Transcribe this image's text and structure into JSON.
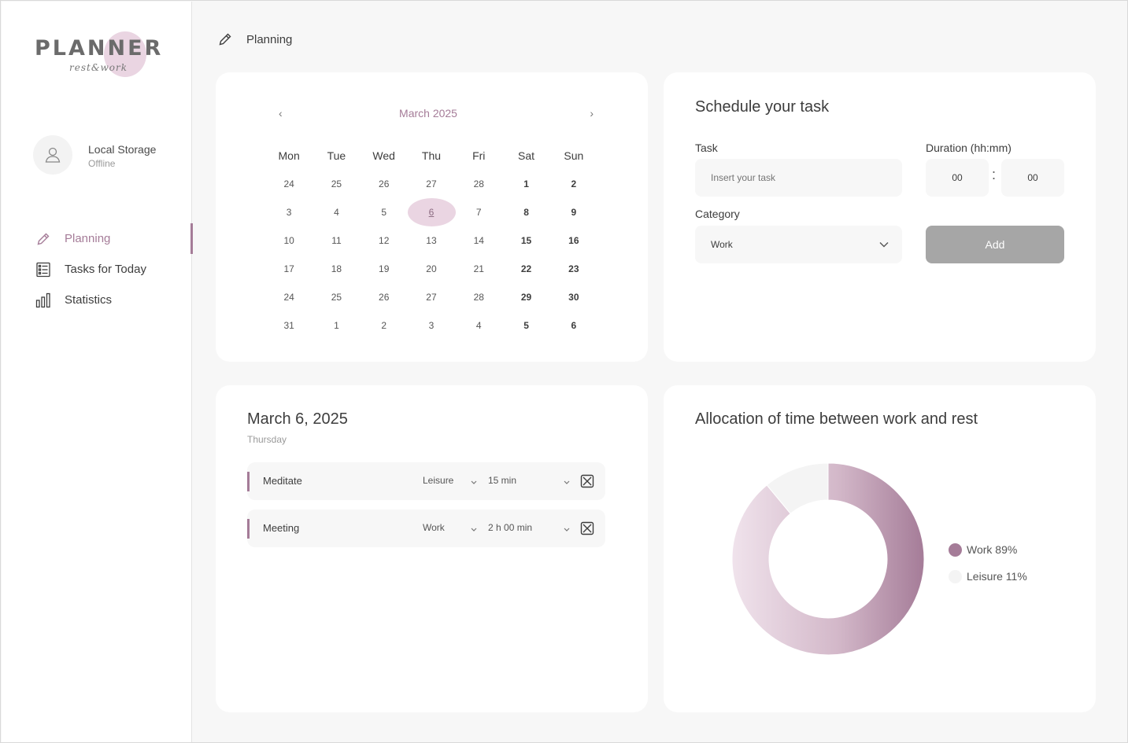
{
  "app": {
    "logo": {
      "title": "PLANNER",
      "subtitle": "rest&work"
    },
    "account": {
      "name": "Local Storage",
      "status": "Offline"
    },
    "nav": [
      {
        "label": "Planning",
        "icon": "pencil-icon",
        "active": true
      },
      {
        "label": "Tasks for Today",
        "icon": "list-icon",
        "active": false
      },
      {
        "label": "Statistics",
        "icon": "bar-chart-icon",
        "active": false
      }
    ],
    "accent_color": "#a57c98",
    "highlight_color": "#ead5e2"
  },
  "header": {
    "title": "Planning",
    "icon": "pencil-icon"
  },
  "calendar": {
    "month_label": "March 2025",
    "prev": "‹",
    "next": "›",
    "weekdays": [
      "Mon",
      "Tue",
      "Wed",
      "Thu",
      "Fri",
      "Sat",
      "Sun"
    ],
    "weeks": [
      [
        "24",
        "25",
        "26",
        "27",
        "28",
        "1",
        "2"
      ],
      [
        "3",
        "4",
        "5",
        "6",
        "7",
        "8",
        "9"
      ],
      [
        "10",
        "11",
        "12",
        "13",
        "14",
        "15",
        "16"
      ],
      [
        "17",
        "18",
        "19",
        "20",
        "21",
        "22",
        "23"
      ],
      [
        "24",
        "25",
        "26",
        "27",
        "28",
        "29",
        "30"
      ],
      [
        "31",
        "1",
        "2",
        "3",
        "4",
        "5",
        "6"
      ]
    ],
    "selected": "6"
  },
  "schedule": {
    "title": "Schedule your task",
    "task_label": "Task",
    "task_placeholder": "Insert your task",
    "duration_label": "Duration (hh:mm)",
    "hours": "00",
    "colon": ":",
    "minutes": "00",
    "category_label": "Category",
    "category_value": "Work",
    "add_label": "Add"
  },
  "day": {
    "date": "March 6, 2025",
    "weekday": "Thursday",
    "tasks": [
      {
        "name": "Meditate",
        "category": "Leisure",
        "duration": "15 min"
      },
      {
        "name": "Meeting",
        "category": "Work",
        "duration": "2 h 00 min"
      }
    ]
  },
  "chart_data": {
    "type": "pie",
    "title": "Allocation of time between work and rest",
    "donut": true,
    "categories": [
      "Work",
      "Leisure"
    ],
    "values": [
      89,
      11
    ],
    "legend_labels": [
      "Work 89%",
      "Leisure 11%"
    ],
    "colors": [
      "#a57c98",
      "#f4f4f4"
    ],
    "legend_position": "right"
  }
}
